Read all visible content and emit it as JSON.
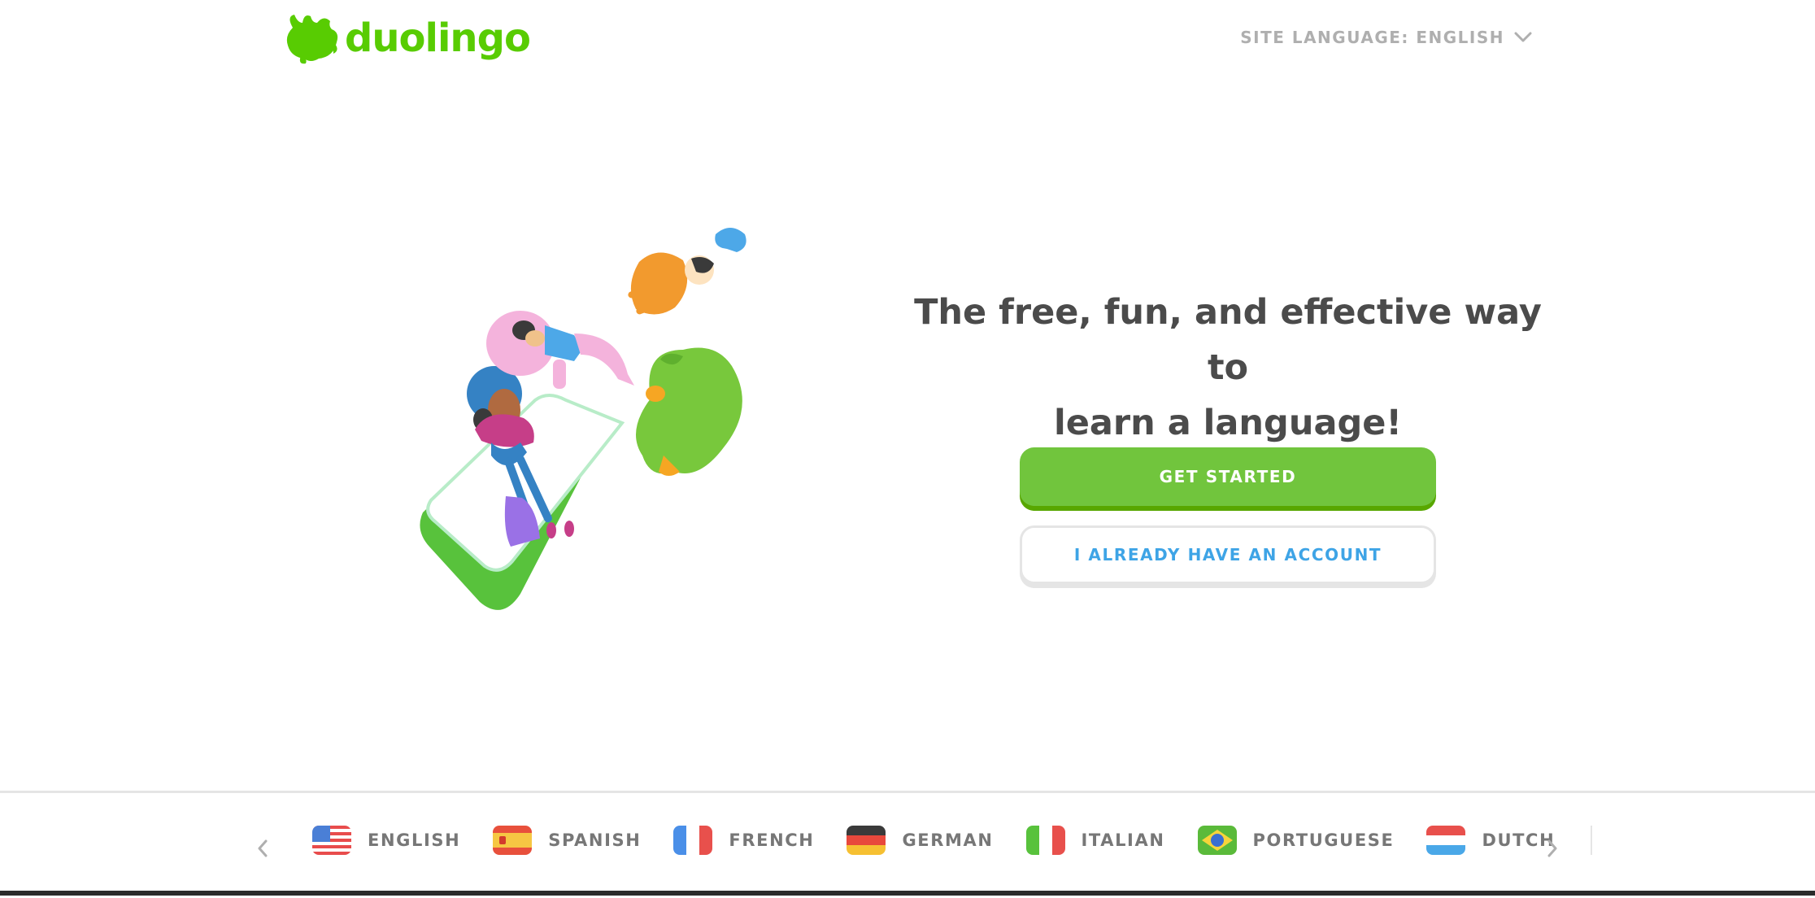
{
  "header": {
    "logo_text": "duolingo",
    "site_language_label": "SITE LANGUAGE: ENGLISH"
  },
  "hero": {
    "headline_line1": "The free, fun, and effective way to",
    "headline_line2": "learn a language!",
    "get_started_label": "GET STARTED",
    "have_account_label": "I ALREADY HAVE AN ACCOUNT"
  },
  "languages": {
    "items": [
      {
        "label": "ENGLISH",
        "flag_icon": "us-flag-icon"
      },
      {
        "label": "SPANISH",
        "flag_icon": "spain-flag-icon"
      },
      {
        "label": "FRENCH",
        "flag_icon": "france-flag-icon"
      },
      {
        "label": "GERMAN",
        "flag_icon": "germany-flag-icon"
      },
      {
        "label": "ITALIAN",
        "flag_icon": "italy-flag-icon"
      },
      {
        "label": "PORTUGUESE",
        "flag_icon": "brazil-flag-icon"
      },
      {
        "label": "DUTCH",
        "flag_icon": "netherlands-flag-icon"
      }
    ]
  },
  "colors": {
    "brand_green": "#58cc02",
    "button_green": "#71c53d",
    "link_blue": "#3ea4e6",
    "text_dark": "#4b4b4b",
    "text_muted": "#afafaf"
  }
}
